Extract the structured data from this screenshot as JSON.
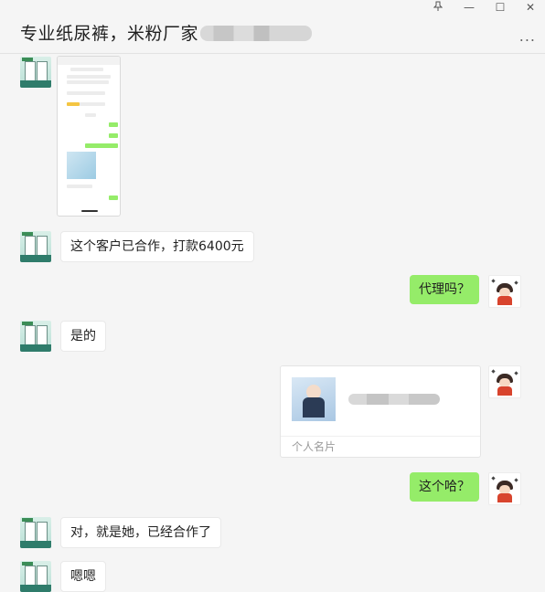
{
  "header": {
    "title": "专业纸尿裤，米粉厂家",
    "pin_icon": "pin-icon",
    "minimize_glyph": "—",
    "maximize_glyph": "☐",
    "close_glyph": "✕",
    "more_glyph": "..."
  },
  "messages": [
    {
      "side": "left",
      "type": "image",
      "text": ""
    },
    {
      "side": "left",
      "type": "text",
      "text": "这个客户已合作，打款6400元"
    },
    {
      "side": "right",
      "type": "text",
      "text": "代理吗？"
    },
    {
      "side": "left",
      "type": "text",
      "text": "是的"
    },
    {
      "side": "right",
      "type": "card",
      "text": "个人名片"
    },
    {
      "side": "right",
      "type": "text",
      "text": "这个哈？"
    },
    {
      "side": "left",
      "type": "text",
      "text": "对，就是她，已经合作了"
    },
    {
      "side": "left",
      "type": "text",
      "text": "嗯嗯"
    }
  ],
  "colors": {
    "background": "#f5f5f5",
    "outgoing_bubble": "#95ec69",
    "incoming_bubble": "#ffffff"
  }
}
